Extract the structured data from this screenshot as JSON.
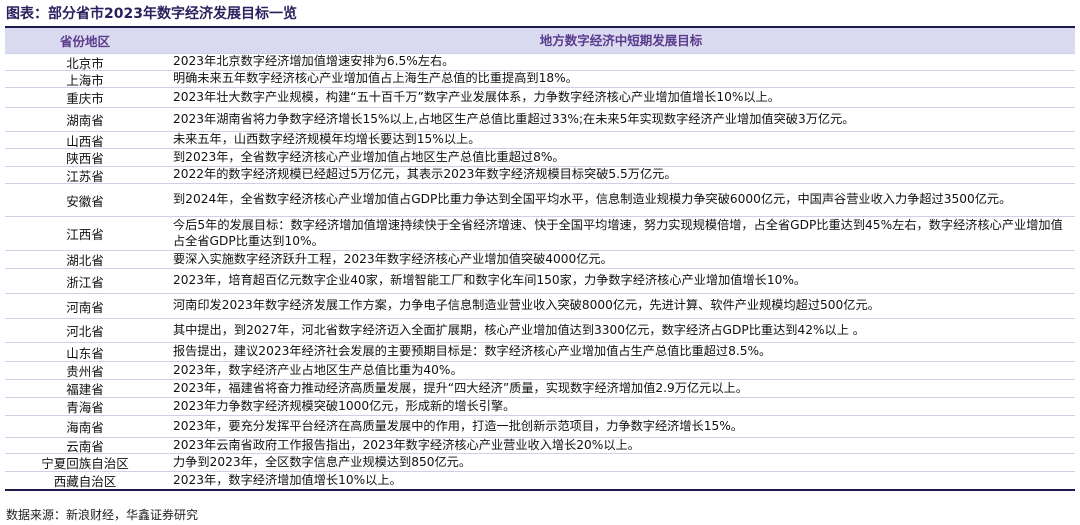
{
  "title": "图表：部分省市2023年数字经济发展目标一览",
  "headers": {
    "region": "省份地区",
    "target": "地方数字经济中短期发展目标"
  },
  "rows": [
    {
      "region": "北京市",
      "text": "2023年北京数字经济增加值增速安排为6.5%左右。",
      "h": 16
    },
    {
      "region": "上海市",
      "text": "明确未来五年数字经济核心产业增加值占上海生产总值的比重提高到18%。",
      "h": 16
    },
    {
      "region": "重庆市",
      "text": "2023年壮大数字产业规模，构建“五十百千万”数字产业发展体系，力争数字经济核心产业增加值增长10%以上。",
      "h": 19
    },
    {
      "region": "湖南省",
      "text": "2023年湖南省将力争数字经济增长15%以上,占地区生产总值比重超过33%;在未来5年实现数字经济产业增加值突破3万亿元。",
      "h": 23
    },
    {
      "region": "山西省",
      "text": "未来五年，山西数字经济规模年均增长要达到15%以上。",
      "h": 16
    },
    {
      "region": "陕西省",
      "text": "到2023年，全省数字经济核心产业增加值占地区生产总值比重超过8%。",
      "h": 17
    },
    {
      "region": "江苏省",
      "text": "2022年的数字经济规模已经超过5万亿元，其表示2023年数字经济规模目标突破5.5万亿元。",
      "h": 16
    },
    {
      "region": "安徽省",
      "text": "到2024年，全省数字经济核心产业增加值占GDP比重力争达到全国平均水平，信息制造业规模力争突破6000亿元，中国声谷营业收入力争超过3500亿元。",
      "h": 32,
      "wrap": true
    },
    {
      "region": "江西省",
      "text": "今后5年的发展目标：数字经济增加值增速持续快于全省经济增速、快于全国平均增速，努力实现规模倍增，占全省GDP比重达到45%左右，数字经济核心产业增加值占全省GDP比重达到10%。",
      "h": 33,
      "wrap": true
    },
    {
      "region": "湖北省",
      "text": "要深入实施数字经济跃升工程，2023年数字经济核心产业增加值突破4000亿元。",
      "h": 17
    },
    {
      "region": "浙江省",
      "text": "2023年，培育超百亿元数字企业40家，新增智能工厂和数字化车间150家，力争数字经济核心产业增加值增长10%。",
      "h": 24
    },
    {
      "region": "河南省",
      "text": "河南印发2023年数字经济发展工作方案，力争电子信息制造业营业收入突破8000亿元，先进计算、软件产业规模均超过500亿元。",
      "h": 24
    },
    {
      "region": "河北省",
      "text": "其中提出，到2027年，河北省数字经济迈入全面扩展期，核心产业增加值达到3300亿元，数字经济占GDP比重达到42%以上 。",
      "h": 23
    },
    {
      "region": "山东省",
      "text": "报告提出，建议2023年经济社会发展的主要预期目标是：数字经济核心产业增加值占生产总值比重超过8.5%。",
      "h": 18
    },
    {
      "region": "贵州省",
      "text": "2023年，数字经济产业占地区生产总值比重为40%。",
      "h": 17
    },
    {
      "region": "福建省",
      "text": "2023年，福建省将奋力推动经济高质量发展，提升“四大经济”质量，实现数字经济增加值2.9万亿元以上。",
      "h": 17
    },
    {
      "region": "青海省",
      "text": "2023年力争数字经济规模突破1000亿元，形成新的增长引擎。",
      "h": 17
    },
    {
      "region": "海南省",
      "text": "2023年，要充分发挥平台经济在高质量发展中的作用，打造一批创新示范项目，力争数字经济增长15%。",
      "h": 21
    },
    {
      "region": "云南省",
      "text": "2023年云南省政府工作报告指出，2023年数字经济核心产业营业收入增长20%以上。",
      "h": 15
    },
    {
      "region": "宁夏回族自治区",
      "text": "力争到2023年，全区数字信息产业规模达到850亿元。",
      "h": 17
    },
    {
      "region": "西藏自治区",
      "text": "2023年，数字经济增加值增长10%以上。",
      "h": 17
    }
  ],
  "source": "数据来源：新浪财经，华鑫证券研究"
}
